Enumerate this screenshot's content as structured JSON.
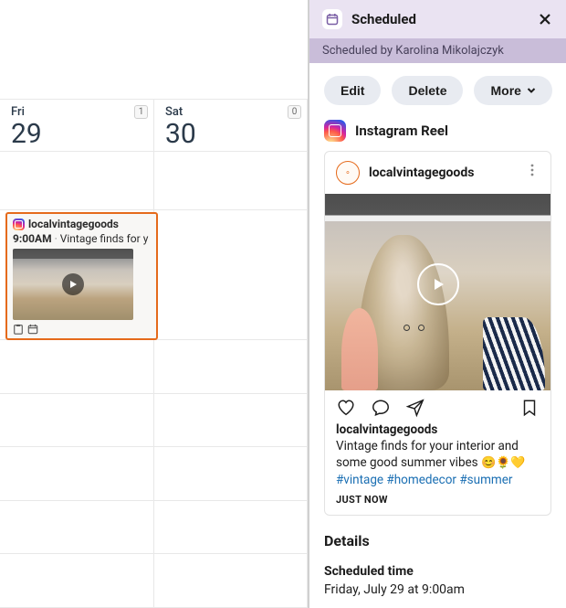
{
  "calendar": {
    "days": [
      {
        "dow": "Fri",
        "date": "29",
        "badge": "1"
      },
      {
        "dow": "Sat",
        "date": "30",
        "badge": "0"
      }
    ],
    "event": {
      "account": "localvintagegoods",
      "time": "9:00AM",
      "preview": "Vintage finds for y"
    }
  },
  "panel": {
    "title": "Scheduled",
    "subtitle": "Scheduled by Karolina Mikolajczyk",
    "buttons": {
      "edit": "Edit",
      "delete": "Delete",
      "more": "More"
    },
    "post_type": "Instagram Reel",
    "account": "localvintagegoods",
    "caption_user": "localvintagegoods",
    "caption_text": "Vintage finds for your interior and some good summer vibes ",
    "caption_emojis": "😊🌻💛",
    "hashtags": "#vintage #homedecor #summer",
    "timestamp": "JUST NOW",
    "details_heading": "Details",
    "scheduled_label": "Scheduled time",
    "scheduled_value": "Friday, July 29 at 9:00am"
  }
}
